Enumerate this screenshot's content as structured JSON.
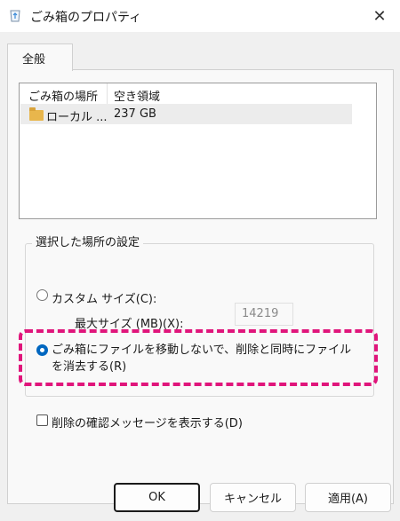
{
  "window": {
    "title": "ごみ箱のプロパティ",
    "close_glyph": "✕",
    "app_icon": "recycle-bin-icon"
  },
  "tabs": [
    {
      "label": "全般",
      "selected": true
    }
  ],
  "listview": {
    "columns": [
      "ごみ箱の場所",
      "空き領域"
    ],
    "rows": [
      {
        "location": "ローカル ...",
        "free": "237 GB",
        "icon": "folder-icon"
      }
    ]
  },
  "group": {
    "label": "選択した場所の設定",
    "custom_size_label": "カスタム サイズ(C):",
    "max_size_label": "最大サイズ (MB)(X):",
    "max_size_value": "14219",
    "delete_immediately_label": "ごみ箱にファイルを移動しないで、削除と同時にファイルを消去する(R)",
    "selected_option": "delete_immediately"
  },
  "confirm_checkbox": {
    "label": "削除の確認メッセージを表示する(D)",
    "checked": false
  },
  "buttons": {
    "ok": "OK",
    "cancel": "キャンセル",
    "apply": "適用(A)"
  },
  "colors": {
    "accent": "#0067c0",
    "highlight": "#e0157b"
  }
}
